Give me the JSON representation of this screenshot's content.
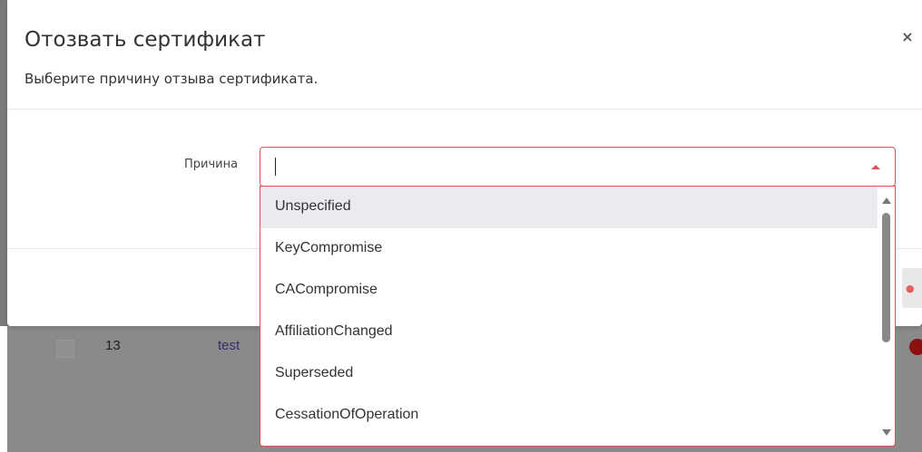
{
  "modal": {
    "title": "Отозвать сертификат",
    "subtitle": "Выберите причину отзыва сертификата.",
    "close_icon": "×",
    "field_label": "Причина",
    "select_value": "",
    "options": [
      "Unspecified",
      "KeyCompromise",
      "CACompromise",
      "AffiliationChanged",
      "Superseded",
      "CessationOfOperation"
    ],
    "highlighted_option": "Unspecified"
  },
  "background_table": {
    "row": {
      "id": "13",
      "name": "test"
    }
  },
  "colors": {
    "accent_error": "#d9534f",
    "highlight": "#e9ebee",
    "status_dot": "#8b1010"
  }
}
